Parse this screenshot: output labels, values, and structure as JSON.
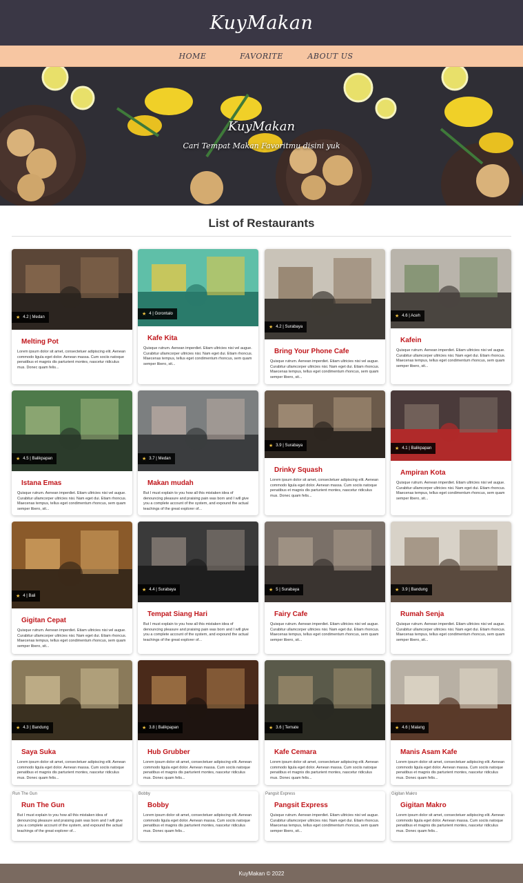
{
  "header": {
    "brand": "KuyMakan"
  },
  "nav": {
    "items": [
      "HOME",
      "FAVORITE",
      "ABOUT US"
    ]
  },
  "hero": {
    "title": "KuyMakan",
    "subtitle": "Cari Tempat Makan Favoritmu disini yuk"
  },
  "list": {
    "title": "List of Restaurants",
    "restaurants": [
      {
        "name": "Melting Pot",
        "badge": "4.2 | Medan",
        "desc": "Lorem ipsum dolor sit amet, consectetuer adipiscing elit. Aenean commodo ligula eget dolor. Aenean massa. Cum sociis natoque penatibus et magnis dis parturient montes, nascetur ridiculus mus. Donec quam felis...",
        "colors": [
          "#5b4637",
          "#2c2520",
          "#8a6a4f"
        ]
      },
      {
        "name": "Kafe Kita",
        "badge": "4 | Gorontalo",
        "desc": "Quisque rutrum. Aenean imperdiet. Etiam ultricies nisi vel augue. Curabitur ullamcorper ultricies nisi. Nam eget dui. Etiam rhoncus. Maecenas tempus, tellus eget condimentum rhoncus, sem quam semper libero, sit...",
        "colors": [
          "#5fbfa8",
          "#2a7b6b",
          "#e0c84a"
        ]
      },
      {
        "name": "Bring Your Phone Cafe",
        "badge": "4.2 | Surabaya",
        "desc": "Quisque rutrum. Aenean imperdiet. Etiam ultricies nisi vel augue. Curabitur ullamcorper ultricies nisi. Nam eget dui. Etiam rhoncus. Maecenas tempus, tellus eget condimentum rhoncus, sem quam semper libero, sit...",
        "colors": [
          "#c9c3b8",
          "#3e3a35",
          "#8f7a64"
        ]
      },
      {
        "name": "Kafein",
        "badge": "4.6 | Aceh",
        "desc": "Quisque rutrum. Aenean imperdiet. Etiam ultricies nisi vel augue. Curabitur ullamcorper ultricies nisi. Nam eget dui. Etiam rhoncus. Maecenas tempus, tellus eget condimentum rhoncus, sem quam semper libero, sit...",
        "colors": [
          "#b9b4ab",
          "#4a4540",
          "#7c8f6a"
        ]
      },
      {
        "name": "Istana Emas",
        "badge": "4.5 | Balikpapan",
        "desc": "Quisque rutrum. Aenean imperdiet. Etiam ultricies nisi vel augue. Curabitur ullamcorper ultricies nisi. Nam eget dui. Etiam rhoncus. Maecenas tempus, tellus eget condimentum rhoncus, sem quam semper libero, sit...",
        "colors": [
          "#4e7a4a",
          "#2b3b2b",
          "#9ab07a"
        ]
      },
      {
        "name": "Makan mudah",
        "badge": "3.7 | Medan",
        "desc": "But I must explain to you how all this mistaken idea of denouncing pleasure and praising pain was born and I will give you a complete account of the system, and expound the actual teachings of the great explorer of...",
        "colors": [
          "#7c7f80",
          "#3b3d3f",
          "#b7a9a0"
        ]
      },
      {
        "name": "Drinky Squash",
        "badge": "3.9 | Surabaya",
        "desc": "Lorem ipsum dolor sit amet, consectetuer adipiscing elit. Aenean commodo ligula eget dolor. Aenean massa. Cum sociis natoque penatibus et magnis dis parturient montes, nascetur ridiculus mus. Donec quam felis...",
        "colors": [
          "#6b5a4a",
          "#2e2721",
          "#a8927a"
        ]
      },
      {
        "name": "Ampiran Kota",
        "badge": "4.1 | Balikpapan",
        "desc": "Quisque rutrum. Aenean imperdiet. Etiam ultricies nisi vel augue. Curabitur ullamcorper ultricies nisi. Nam eget dui. Etiam rhoncus. Maecenas tempus, tellus eget condimentum rhoncus, sem quam semper libero, sit...",
        "colors": [
          "#4a3a3a",
          "#b02a2a",
          "#7a6a62"
        ]
      },
      {
        "name": "Gigitan Cepat",
        "badge": "4 | Bali",
        "desc": "Quisque rutrum. Aenean imperdiet. Etiam ultricies nisi vel augue. Curabitur ullamcorper ultricies nisi. Nam eget dui. Etiam rhoncus. Maecenas tempus, tellus eget condimentum rhoncus, sem quam semper libero, sit...",
        "colors": [
          "#8a5a2a",
          "#3a2a1a",
          "#d0a060"
        ]
      },
      {
        "name": "Tempat Siang Hari",
        "badge": "4.4 | Surabaya",
        "desc": "But I must explain to you how all this mistaken idea of denouncing pleasure and praising pain was born and I will give you a complete account of the system, and expound the actual teachings of the great explorer of...",
        "colors": [
          "#3a3a3a",
          "#1e1e1e",
          "#8a8078"
        ]
      },
      {
        "name": "Fairy Cafe",
        "badge": "5 | Surabaya",
        "desc": "Quisque rutrum. Aenean imperdiet. Etiam ultricies nisi vel augue. Curabitur ullamcorper ultricies nisi. Nam eget dui. Etiam rhoncus. Maecenas tempus, tellus eget condimentum rhoncus, sem quam semper libero, sit...",
        "colors": [
          "#7a7068",
          "#3a3430",
          "#a89a8a"
        ]
      },
      {
        "name": "Rumah Senja",
        "badge": "3.9 | Bandung",
        "desc": "Quisque rutrum. Aenean imperdiet. Etiam ultricies nisi vel augue. Curabitur ullamcorper ultricies nisi. Nam eget dui. Etiam rhoncus. Maecenas tempus, tellus eget condimentum rhoncus, sem quam semper libero, sit...",
        "colors": [
          "#d8d2c8",
          "#5a4a3e",
          "#9a8a78"
        ]
      },
      {
        "name": "Saya Suka",
        "badge": "4.3 | Bandung",
        "desc": "Lorem ipsum dolor sit amet, consectetuer adipiscing elit. Aenean commodo ligula eget dolor. Aenean massa. Cum sociis natoque penatibus et magnis dis parturient montes, nascetur ridiculus mus. Donec quam felis...",
        "colors": [
          "#8a7a5a",
          "#3a3020",
          "#c8b890"
        ]
      },
      {
        "name": "Hub Grubber",
        "badge": "3.8 | Balikpapan",
        "desc": "Lorem ipsum dolor sit amet, consectetuer adipiscing elit. Aenean commodo ligula eget dolor. Aenean massa. Cum sociis natoque penatibus et magnis dis parturient montes, nascetur ridiculus mus. Donec quam felis...",
        "colors": [
          "#4a2a1a",
          "#1e1410",
          "#a87a4a"
        ]
      },
      {
        "name": "Kafe Cemara",
        "badge": "3.6 | Ternate",
        "desc": "Lorem ipsum dolor sit amet, consectetuer adipiscing elit. Aenean commodo ligula eget dolor. Aenean massa. Cum sociis natoque penatibus et magnis dis parturient montes, nascetur ridiculus mus. Donec quam felis...",
        "colors": [
          "#5a5a4a",
          "#2a2a22",
          "#9a8a6a"
        ]
      },
      {
        "name": "Manis Asam Kafe",
        "badge": "4.6 | Malang",
        "desc": "Lorem ipsum dolor sit amet, consectetuer adipiscing elit. Aenean commodo ligula eget dolor. Aenean massa. Cum sociis natoque penatibus et magnis dis parturient montes, nascetur ridiculus mus. Donec quam felis...",
        "colors": [
          "#b8b0a4",
          "#5a3a2a",
          "#e0d8c8"
        ]
      },
      {
        "name": "Run The Gun",
        "alt": "Run The Gun",
        "desc": "But I must explain to you how all this mistaken idea of denouncing pleasure and praising pain was born and I will give you a complete account of the system, and expound the actual teachings of the great explorer of..."
      },
      {
        "name": "Bobby",
        "alt": "Bobby",
        "desc": "Lorem ipsum dolor sit amet, consectetuer adipiscing elit. Aenean commodo ligula eget dolor. Aenean massa. Cum sociis natoque penatibus et magnis dis parturient montes, nascetur ridiculus mus. Donec quam felis..."
      },
      {
        "name": "Pangsit Express",
        "alt": "Pangsit Express",
        "desc": "Quisque rutrum. Aenean imperdiet. Etiam ultricies nisi vel augue. Curabitur ullamcorper ultricies nisi. Nam eget dui. Etiam rhoncus. Maecenas tempus, tellus eget condimentum rhoncus, sem quam semper libero, sit..."
      },
      {
        "name": "Gigitan Makro",
        "alt": "Gigitan Makro",
        "desc": "Lorem ipsum dolor sit amet, consectetuer adipiscing elit. Aenean commodo ligula eget dolor. Aenean massa. Cum sociis natoque penatibus et magnis dis parturient montes, nascetur ridiculus mus. Donec quam felis..."
      }
    ]
  },
  "footer": {
    "text": "KuyMakan © 2022"
  }
}
